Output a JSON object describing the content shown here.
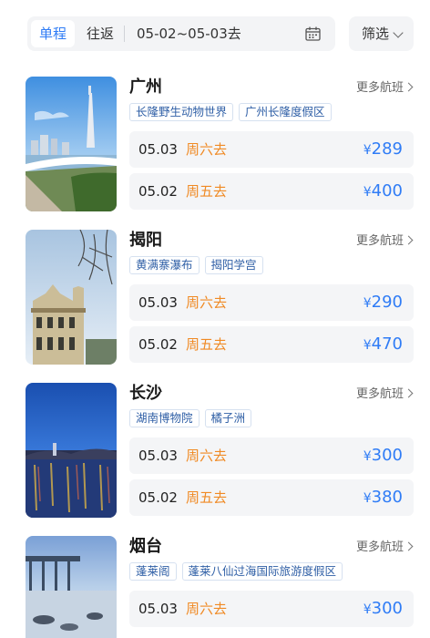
{
  "trip_tabs": {
    "one_way": "单程",
    "round_trip": "往返"
  },
  "date_range": "05-02~05-03去",
  "calendar_icon": "calendar-icon",
  "filter": {
    "label": "筛选",
    "icon": "chevron-down-icon"
  },
  "more_label": "更多航班",
  "cities": [
    {
      "name": "广州",
      "tags": [
        "长隆野生动物世界",
        "广州长隆度假区"
      ],
      "fares": [
        {
          "date": "05.03",
          "day": "周六去",
          "currency": "¥",
          "price": "289"
        },
        {
          "date": "05.02",
          "day": "周五去",
          "currency": "¥",
          "price": "400"
        }
      ]
    },
    {
      "name": "揭阳",
      "tags": [
        "黄满寨瀑布",
        "揭阳学宫"
      ],
      "fares": [
        {
          "date": "05.03",
          "day": "周六去",
          "currency": "¥",
          "price": "290"
        },
        {
          "date": "05.02",
          "day": "周五去",
          "currency": "¥",
          "price": "470"
        }
      ]
    },
    {
      "name": "长沙",
      "tags": [
        "湖南博物院",
        "橘子洲"
      ],
      "fares": [
        {
          "date": "05.03",
          "day": "周六去",
          "currency": "¥",
          "price": "300"
        },
        {
          "date": "05.02",
          "day": "周五去",
          "currency": "¥",
          "price": "380"
        }
      ]
    },
    {
      "name": "烟台",
      "tags": [
        "蓬莱阁",
        "蓬莱八仙过海国际旅游度假区"
      ],
      "fares": [
        {
          "date": "05.03",
          "day": "周六去",
          "currency": "¥",
          "price": "300"
        }
      ]
    }
  ],
  "colors": {
    "accent": "#2f7cf6",
    "weekday": "#f08a24",
    "tag_text": "#2f5fa6",
    "fare_bg": "#f4f5f7"
  }
}
